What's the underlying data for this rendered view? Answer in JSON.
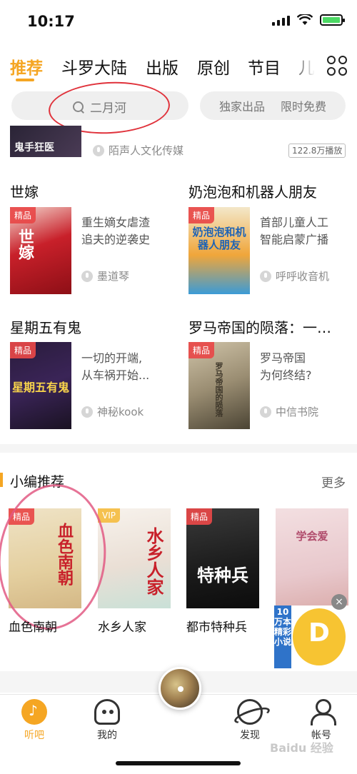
{
  "status_bar": {
    "time": "10:17"
  },
  "tabs": [
    {
      "label": "推荐",
      "active": true
    },
    {
      "label": "斗罗大陆"
    },
    {
      "label": "出版"
    },
    {
      "label": "原创"
    },
    {
      "label": "节目"
    },
    {
      "label": "儿"
    }
  ],
  "search": {
    "placeholder": "二月河"
  },
  "pills": [
    "独家出品",
    "限时免费"
  ],
  "top_item": {
    "cover_title": "鬼手狂医",
    "author": "陌声人文化传媒",
    "plays": "122.8万播放"
  },
  "books": [
    {
      "title": "世嫁",
      "tag": "精品",
      "desc_line1": "重生嫡女虐渣",
      "desc_line2": "追夫的逆袭史",
      "author": "墨道琴",
      "cover_text": "世嫁"
    },
    {
      "title": "奶泡泡和机器人朋友",
      "tag": "精品",
      "desc_line1": "首部儿童人工",
      "desc_line2": "智能启蒙广播",
      "author": "呼呼收音机",
      "cover_text": "奶泡泡和机器人朋友"
    },
    {
      "title": "星期五有鬼",
      "tag": "精品",
      "desc_line1": "一切的开端,",
      "desc_line2": "从车祸开始...",
      "author": "神秘kook",
      "cover_text": "星期五有鬼"
    },
    {
      "title": "罗马帝国的陨落：一…",
      "tag": "精品",
      "desc_line1": "罗马帝国",
      "desc_line2": "为何终结?",
      "author": "中信书院",
      "cover_text": "罗马帝国的陨落"
    }
  ],
  "picks_section": {
    "title": "小编推荐",
    "more": "更多"
  },
  "picks": [
    {
      "label": "血色南朝",
      "tag": "精品",
      "cover_text": "血色南朝"
    },
    {
      "label": "水乡人家",
      "tag": "VIP",
      "cover_text": "水乡人家"
    },
    {
      "label": "都市特种兵",
      "tag": "精品",
      "cover_text": "特种兵"
    },
    {
      "label": "",
      "tag": "",
      "cover_text": "学会爱"
    }
  ],
  "ad": {
    "side_text": "10万本精彩小说",
    "big_letter": "D"
  },
  "bottom_nav": [
    {
      "label": "听吧",
      "icon": "headphone-disc-icon",
      "active": true
    },
    {
      "label": "我的",
      "icon": "headphones-icon"
    },
    {
      "label": "发现",
      "icon": "planet-icon"
    },
    {
      "label": "帐号",
      "icon": "person-icon"
    }
  ],
  "watermark": "Baidu 经验",
  "colors": {
    "accent": "#f5a623",
    "annotation_red": "#e0323b",
    "annotation_pink": "#e25a84"
  }
}
